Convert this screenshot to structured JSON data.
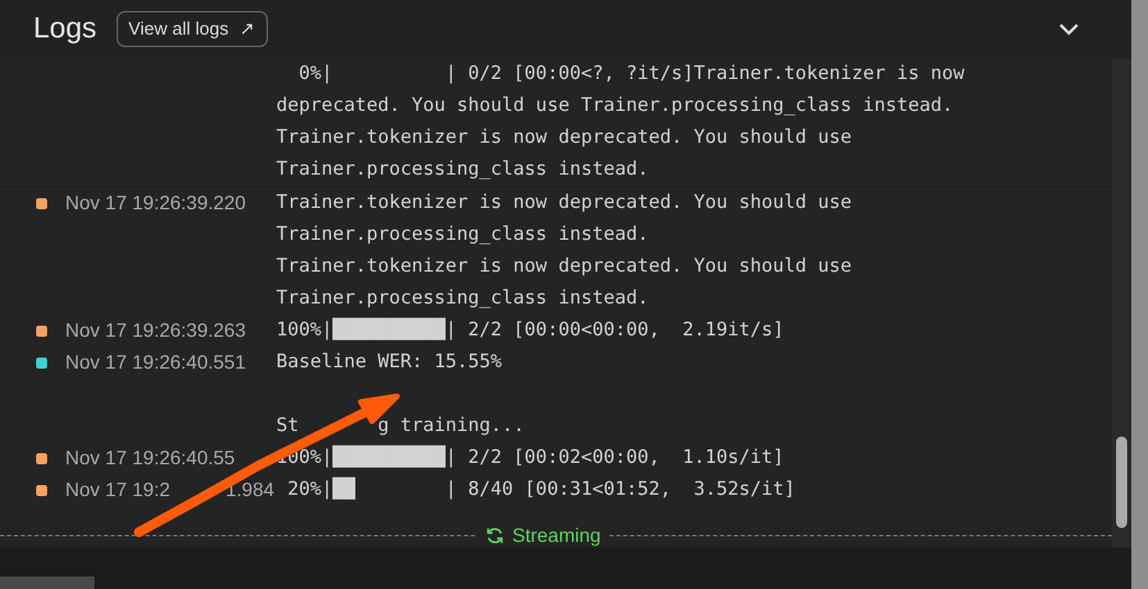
{
  "header": {
    "title": "Logs",
    "link": "View all logs",
    "link_icon": "↗"
  },
  "entries": [
    {
      "lines": [
        {
          "parts": [
            "  0%|          | 0/2 [00:00<?, ?it/s]Trainer.tokenizer is now"
          ]
        },
        {
          "parts": [
            "deprecated. You should use Trainer.processing_class instead."
          ]
        },
        {
          "parts": [
            "Trainer.tokenizer is now deprecated. You should use"
          ]
        },
        {
          "parts": [
            "Trainer.processing_class instead."
          ]
        }
      ]
    },
    {
      "time": [
        "Nov 17 19:26:39.220"
      ],
      "color": "#f4a261",
      "lines": [
        {
          "parts": [
            "Trainer.tokenizer is now deprecated. You should use"
          ]
        },
        {
          "parts": [
            "Trainer.processing_class instead."
          ]
        },
        {
          "parts": [
            "Trainer.tokenizer is now deprecated. You should use"
          ]
        },
        {
          "parts": [
            "Trainer.processing_class instead."
          ]
        }
      ]
    },
    {
      "time": [
        "Nov 17 19:26:39.263"
      ],
      "color": "#f4a261",
      "lines": [
        {
          "parts": [
            "100%|██████████| 2/2 [00:00<00:00,  2.19it/s]"
          ]
        }
      ]
    },
    {
      "time": [
        "Nov 17 19:26:40.551"
      ],
      "color": "#3fcfd6",
      "lines": [
        {
          "parts": [
            "Baseline WER: 15.55%"
          ]
        },
        {
          "parts": [
            "St",
            "g training..."
          ],
          "gap_before": true
        }
      ]
    },
    {
      "time": [
        "Nov 17 19:26:40.55"
      ],
      "color": "#f4a261",
      "lines": [
        {
          "parts": [
            "100%|██████████| 2/2 [00:02<00:00,  1.10s/it]"
          ]
        }
      ]
    },
    {
      "time": [
        "Nov 17 19:2",
        "1.984"
      ],
      "color": "#f4a261",
      "lines": [
        {
          "parts": [
            " 20%|██        | 8/40 [00:31<01:52,  3.52s/it]"
          ]
        }
      ]
    }
  ],
  "streaming": {
    "label": "Streaming"
  }
}
